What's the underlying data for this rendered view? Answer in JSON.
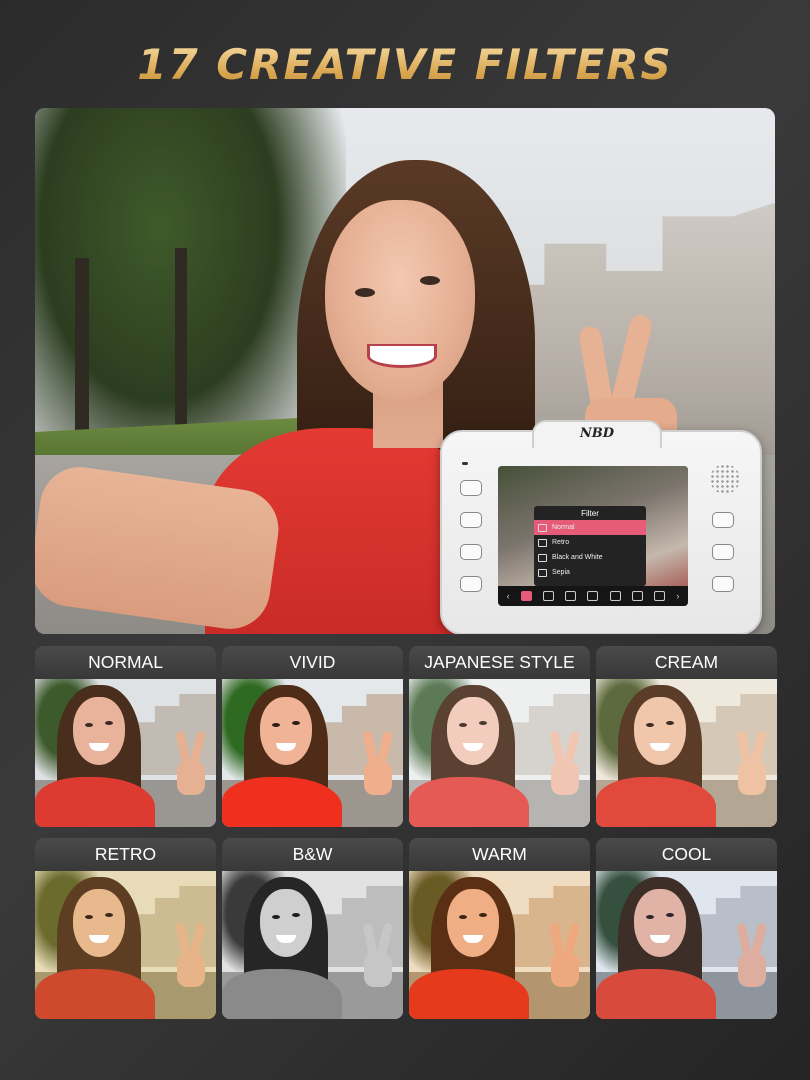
{
  "headline": "17 CREATIVE FILTERS",
  "camera": {
    "brand": "NBD",
    "menu_title": "Filter",
    "menu_items": [
      "Normal",
      "Retro",
      "Black and White",
      "Sepia"
    ],
    "selected_item": "Normal"
  },
  "filters": [
    {
      "label": "NORMAL",
      "style": "normal"
    },
    {
      "label": "VIVID",
      "style": "vivid"
    },
    {
      "label": "JAPANESE STYLE",
      "style": "japanese"
    },
    {
      "label": "CREAM",
      "style": "cream"
    },
    {
      "label": "RETRO",
      "style": "retro"
    },
    {
      "label": "B&W",
      "style": "bw"
    },
    {
      "label": "WARM",
      "style": "warm"
    },
    {
      "label": "COOL",
      "style": "cool"
    }
  ],
  "colors": {
    "headline_gold": "#d9a650",
    "shirt_red": "#e33a33",
    "menu_highlight": "#e65b78"
  }
}
